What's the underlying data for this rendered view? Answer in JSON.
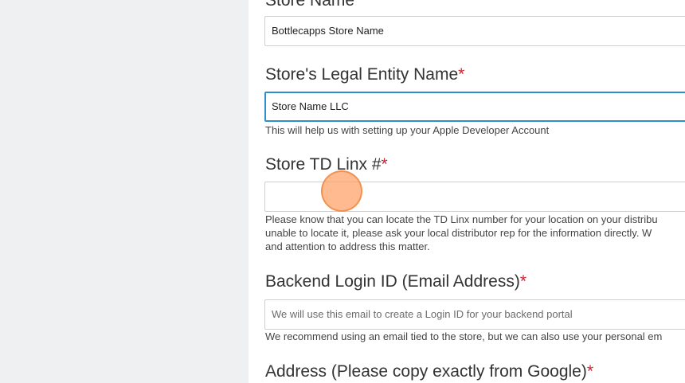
{
  "store_name": {
    "label": "Store Name",
    "required_mark": "*",
    "value": "Bottlecapps Store Name"
  },
  "legal_entity": {
    "label": "Store's Legal Entity Name",
    "required_mark": "*",
    "value": "Store Name LLC",
    "help": "This will help us with setting up your Apple Developer Account"
  },
  "td_linx": {
    "label": "Store TD Linx #",
    "required_mark": "*",
    "value": "",
    "help_lines": [
      "Please know that you can locate the TD Linx number for your location on your distribu",
      "unable to locate it, please ask your local distributor rep for the information directly. W",
      "and attention to address this matter."
    ]
  },
  "backend_login": {
    "label": "Backend Login ID (Email Address)",
    "required_mark": "*",
    "placeholder": "We will use this email to create a Login ID for your backend portal",
    "help": "We recommend using an email tied to the store, but we can also use your personal em"
  },
  "address": {
    "label": "Address (Please copy exactly from Google)",
    "required_mark": "*"
  },
  "colors": {
    "required": "#cc2233",
    "focus_border": "#2f8fc9",
    "left_panel": "#eff0f1"
  }
}
